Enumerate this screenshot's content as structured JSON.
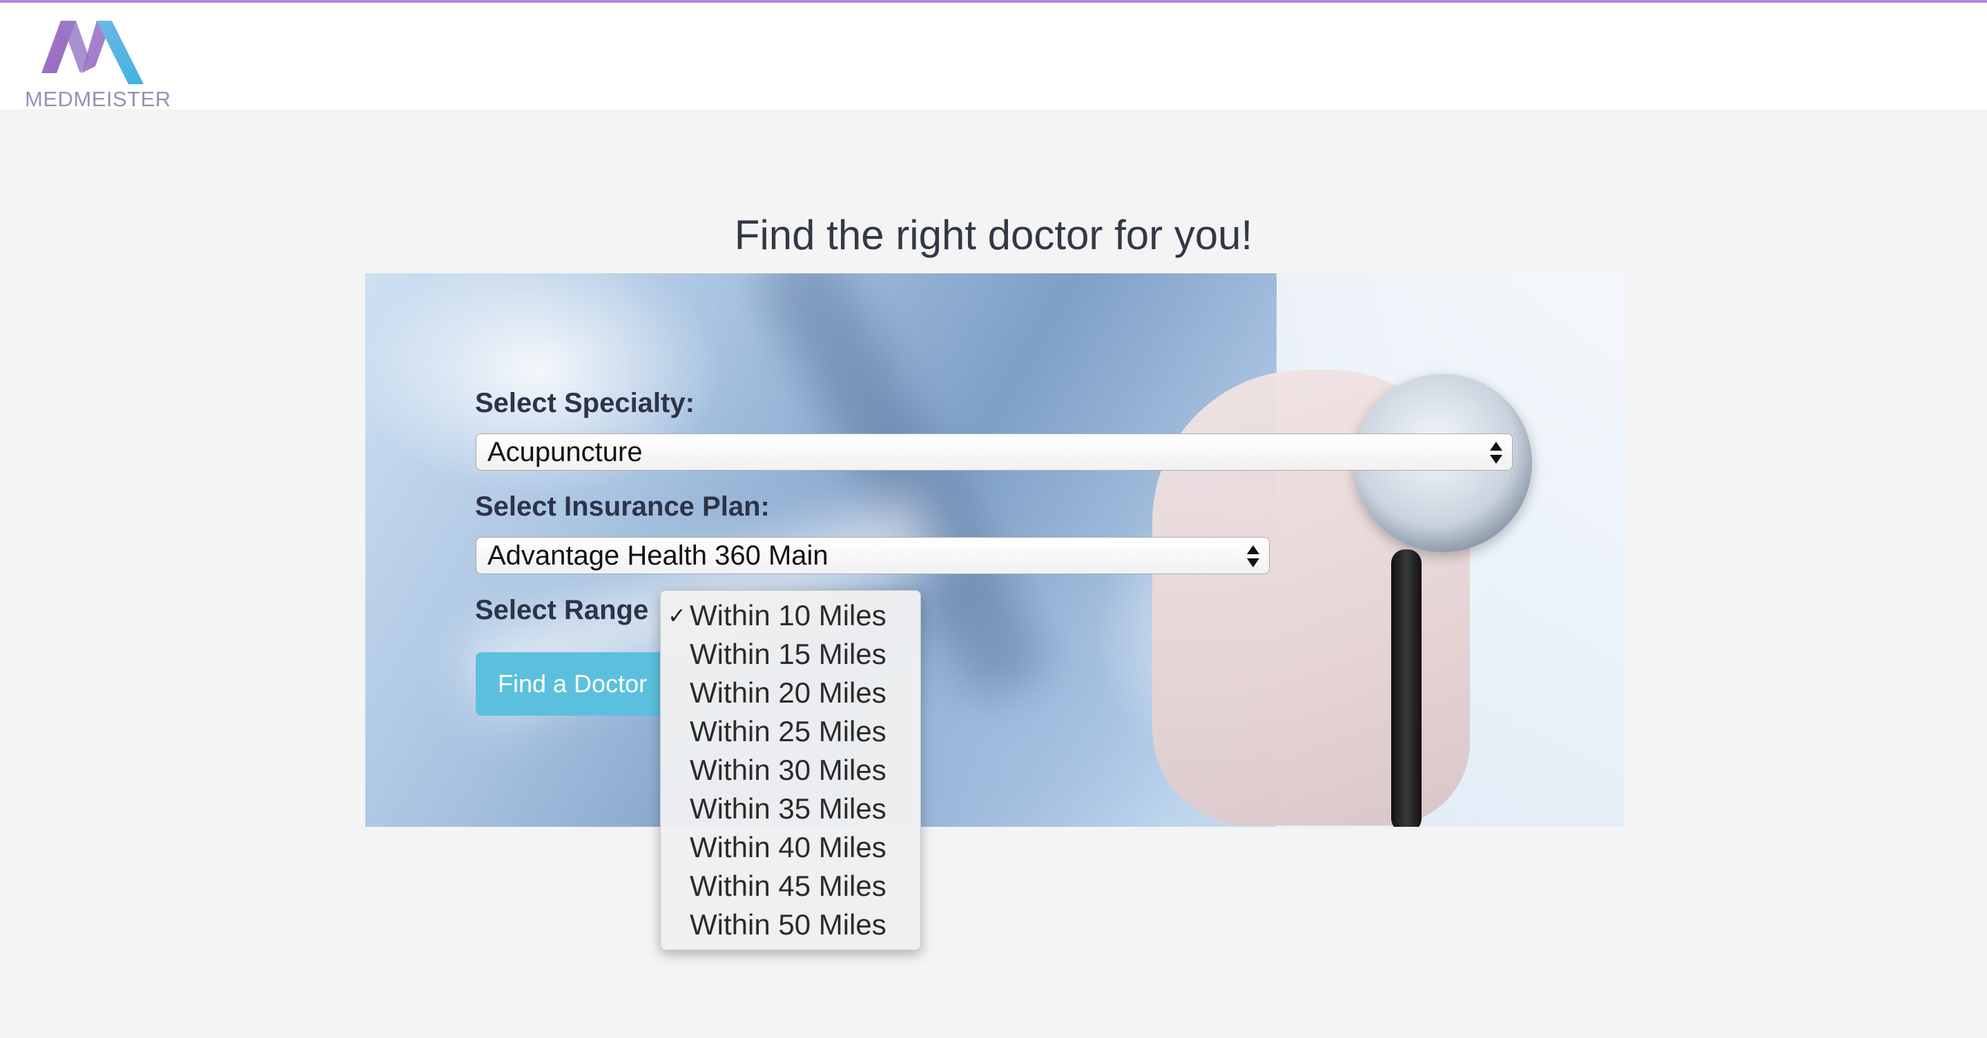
{
  "brand": {
    "name": "MEDMEISTER",
    "accent_color": "#b48ad6"
  },
  "page": {
    "heading": "Find the right doctor for you!"
  },
  "form": {
    "specialty_label": "Select Specialty:",
    "specialty_value": "Acupuncture",
    "insurance_label": "Select Insurance Plan:",
    "insurance_value": "Advantage Health 360 Main",
    "range_label": "Select Range",
    "submit_label": "Find a Doctor",
    "button_color": "#5bc0de"
  },
  "range_dropdown": {
    "selected_index": 0,
    "check_glyph": "✓",
    "options": [
      "Within 10 Miles",
      "Within 15 Miles",
      "Within 20 Miles",
      "Within 25 Miles",
      "Within 30 Miles",
      "Within 35 Miles",
      "Within 40 Miles",
      "Within 45 Miles",
      "Within 50 Miles"
    ]
  }
}
